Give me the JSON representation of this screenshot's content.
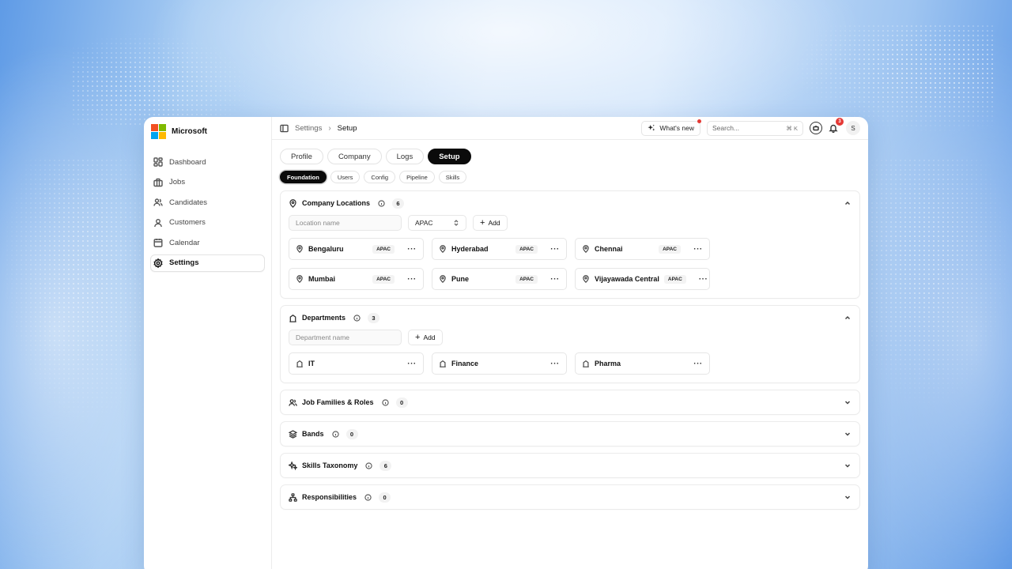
{
  "brand": {
    "name": "Microsoft"
  },
  "sidebar": {
    "items": [
      {
        "label": "Dashboard",
        "icon": "dashboard-icon",
        "active": false
      },
      {
        "label": "Jobs",
        "icon": "briefcase-icon",
        "active": false
      },
      {
        "label": "Candidates",
        "icon": "users-icon",
        "active": false
      },
      {
        "label": "Customers",
        "icon": "user-icon",
        "active": false
      },
      {
        "label": "Calendar",
        "icon": "calendar-icon",
        "active": false
      },
      {
        "label": "Settings",
        "icon": "gear-icon",
        "active": true
      }
    ]
  },
  "header": {
    "breadcrumb": {
      "parent": "Settings",
      "current": "Setup"
    },
    "whats_new": "What's new",
    "search": {
      "placeholder": "Search...",
      "shortcut": "⌘ K"
    },
    "notifications_count": "3",
    "avatar_initial": "S"
  },
  "tabs": [
    {
      "label": "Profile",
      "active": false
    },
    {
      "label": "Company",
      "active": false
    },
    {
      "label": "Logs",
      "active": false
    },
    {
      "label": "Setup",
      "active": true
    }
  ],
  "subtabs": [
    {
      "label": "Foundation",
      "active": true
    },
    {
      "label": "Users",
      "active": false
    },
    {
      "label": "Config",
      "active": false
    },
    {
      "label": "Pipeline",
      "active": false
    },
    {
      "label": "Skills",
      "active": false
    }
  ],
  "sections": {
    "locations": {
      "title": "Company Locations",
      "count": "6",
      "input_placeholder": "Location name",
      "region_select": "APAC",
      "add_label": "Add",
      "items": [
        {
          "name": "Bengaluru",
          "region": "APAC"
        },
        {
          "name": "Hyderabad",
          "region": "APAC"
        },
        {
          "name": "Chennai",
          "region": "APAC"
        },
        {
          "name": "Mumbai",
          "region": "APAC"
        },
        {
          "name": "Pune",
          "region": "APAC"
        },
        {
          "name": "Vijayawada Central",
          "region": "APAC"
        }
      ]
    },
    "departments": {
      "title": "Departments",
      "count": "3",
      "input_placeholder": "Department name",
      "add_label": "Add",
      "items": [
        {
          "name": "IT"
        },
        {
          "name": "Finance"
        },
        {
          "name": "Pharma"
        }
      ]
    },
    "job_families": {
      "title": "Job Families & Roles",
      "count": "0"
    },
    "bands": {
      "title": "Bands",
      "count": "0"
    },
    "skills_taxonomy": {
      "title": "Skills Taxonomy",
      "count": "6"
    },
    "responsibilities": {
      "title": "Responsibilities",
      "count": "0"
    }
  },
  "colors": {
    "accent": "#0b0b0b",
    "badge": "#e53935",
    "logo": [
      "#f25022",
      "#7fba00",
      "#00a4ef",
      "#ffb900"
    ]
  }
}
